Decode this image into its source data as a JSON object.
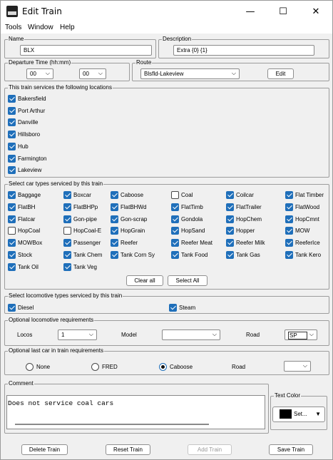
{
  "window": {
    "title": "Edit Train",
    "minimize": "—",
    "maximize": "☐",
    "close": "✕",
    "icon": "train-icon"
  },
  "menu": [
    "Tools",
    "Window",
    "Help"
  ],
  "name": {
    "label": "Name",
    "value": "BLX"
  },
  "description": {
    "label": "Description",
    "value": "Extra {0} {1}"
  },
  "departure": {
    "label": "Departure Time (hh:mm)",
    "hour": "00",
    "minute": "00"
  },
  "route": {
    "label": "Route",
    "value": "Blsfld-Lakeview",
    "edit_button": "Edit"
  },
  "locations": {
    "label": "This train services the following locations",
    "items": [
      {
        "name": "Bakersfield",
        "checked": true
      },
      {
        "name": "Port Arthur",
        "checked": true
      },
      {
        "name": "Danville",
        "checked": true
      },
      {
        "name": "Hillsboro",
        "checked": true
      },
      {
        "name": "Hub",
        "checked": true
      },
      {
        "name": "Farmington",
        "checked": true
      },
      {
        "name": "Lakeview",
        "checked": true
      }
    ]
  },
  "car_types": {
    "label": "Select car types serviced by this train",
    "items": [
      {
        "name": "Baggage",
        "checked": true
      },
      {
        "name": "Boxcar",
        "checked": true
      },
      {
        "name": "Caboose",
        "checked": true
      },
      {
        "name": "Coal",
        "checked": false
      },
      {
        "name": "Coilcar",
        "checked": true
      },
      {
        "name": "Flat Timber",
        "checked": true
      },
      {
        "name": "FlatBH",
        "checked": true
      },
      {
        "name": "FlatBHPp",
        "checked": true
      },
      {
        "name": "FlatBHWd",
        "checked": true
      },
      {
        "name": "FlatTimb",
        "checked": true
      },
      {
        "name": "FlatTrailer",
        "checked": true
      },
      {
        "name": "FlatWood",
        "checked": true
      },
      {
        "name": "Flatcar",
        "checked": true
      },
      {
        "name": "Gon-pipe",
        "checked": true
      },
      {
        "name": "Gon-scrap",
        "checked": true
      },
      {
        "name": "Gondola",
        "checked": true
      },
      {
        "name": "HopChem",
        "checked": true
      },
      {
        "name": "HopCmnt",
        "checked": true
      },
      {
        "name": "HopCoal",
        "checked": false
      },
      {
        "name": "HopCoal-E",
        "checked": false
      },
      {
        "name": "HopGrain",
        "checked": true
      },
      {
        "name": "HopSand",
        "checked": true
      },
      {
        "name": "Hopper",
        "checked": true
      },
      {
        "name": "MOW",
        "checked": true
      },
      {
        "name": "MOWBox",
        "checked": true
      },
      {
        "name": "Passenger",
        "checked": true
      },
      {
        "name": "Reefer",
        "checked": true
      },
      {
        "name": "Reefer Meat",
        "checked": true
      },
      {
        "name": "Reefer Milk",
        "checked": true
      },
      {
        "name": "ReeferIce",
        "checked": true
      },
      {
        "name": "Stock",
        "checked": true
      },
      {
        "name": "Tank Chem",
        "checked": true
      },
      {
        "name": "Tank Corn Sy",
        "checked": true
      },
      {
        "name": "Tank Food",
        "checked": true
      },
      {
        "name": "Tank Gas",
        "checked": true
      },
      {
        "name": "Tank Kero",
        "checked": true
      },
      {
        "name": "Tank Oil",
        "checked": true
      },
      {
        "name": "Tank Veg",
        "checked": true
      }
    ],
    "clear_all": "Clear all",
    "select_all": "Select All"
  },
  "loco_types": {
    "label": "Select locomotive types serviced by this train",
    "items": [
      {
        "name": "Diesel",
        "checked": true
      },
      {
        "name": "Steam",
        "checked": true
      }
    ]
  },
  "loco_req": {
    "label": "Optional locomotive requirements",
    "locos_label": "Locos",
    "locos_value": "1",
    "model_label": "Model",
    "model_value": "",
    "road_label": "Road",
    "road_value": "SP"
  },
  "last_car": {
    "label": "Optional last car in train requirements",
    "options": [
      "None",
      "FRED",
      "Caboose"
    ],
    "selected": "Caboose",
    "road_label": "Road",
    "road_value": ""
  },
  "comment": {
    "label": "Comment",
    "value": "Does not service coal cars"
  },
  "text_color": {
    "label": "Text Color",
    "button": "Set...",
    "color": "#000000"
  },
  "footer": {
    "delete": "Delete Train",
    "reset": "Reset Train",
    "add": "Add Train",
    "save": "Save Train"
  }
}
